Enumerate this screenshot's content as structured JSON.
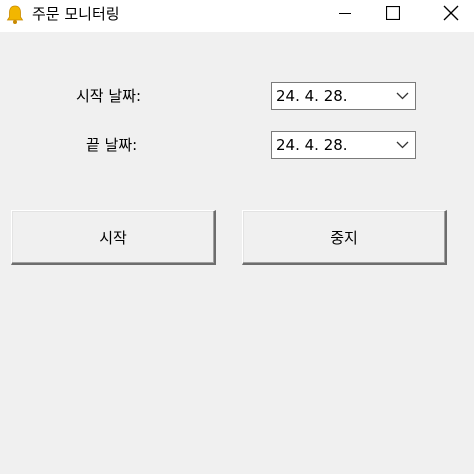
{
  "window": {
    "title": "주문 모니터링",
    "icon": "bell-icon",
    "controls": [
      "minimize-icon",
      "maximize-icon",
      "close-icon"
    ]
  },
  "form": {
    "start_date_label": "시작 날짜:",
    "start_date_value": "24. 4. 28.",
    "end_date_label": "끝 날짜:",
    "end_date_value": "24. 4. 28."
  },
  "buttons": {
    "start_label": "시작",
    "stop_label": "중지"
  },
  "colors": {
    "window_bg": "#f0f0f0",
    "titlebar_bg": "#ffffff",
    "bell": "#f2b600"
  }
}
